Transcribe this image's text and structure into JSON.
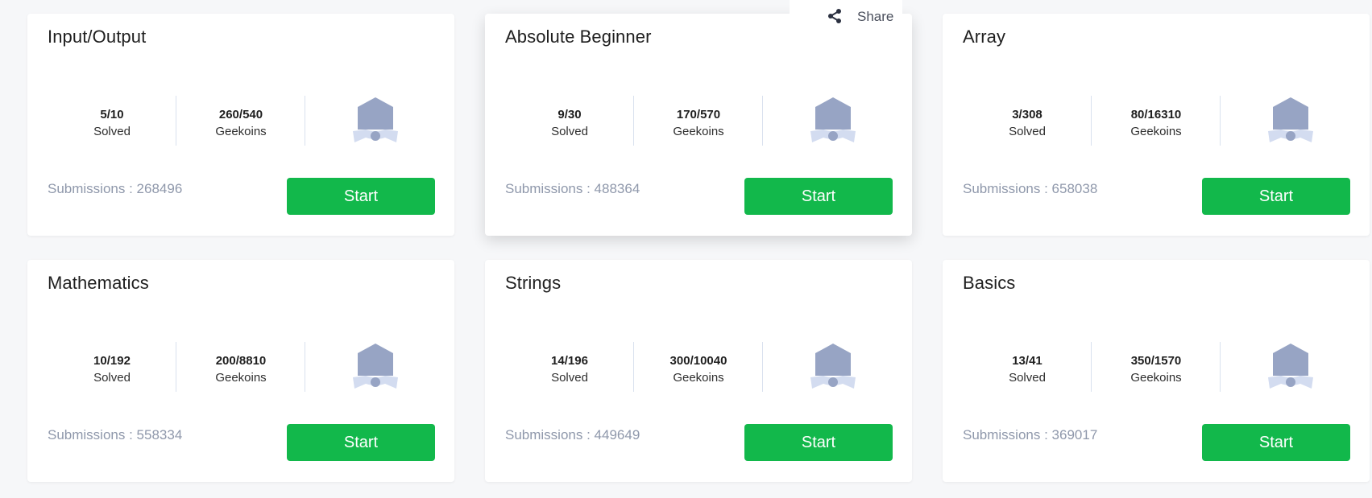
{
  "share": {
    "label": "Share",
    "icon": "share-icon"
  },
  "cards": [
    {
      "title": "Input/Output",
      "solved": "5/10",
      "solved_label": "Solved",
      "geekoins": "260/540",
      "geekoins_label": "Geekoins",
      "submissions": "Submissions : 268496",
      "button": "Start"
    },
    {
      "title": "Absolute Beginner",
      "solved": "9/30",
      "solved_label": "Solved",
      "geekoins": "170/570",
      "geekoins_label": "Geekoins",
      "submissions": "Submissions : 488364",
      "button": "Start"
    },
    {
      "title": "Array",
      "solved": "3/308",
      "solved_label": "Solved",
      "geekoins": "80/16310",
      "geekoins_label": "Geekoins",
      "submissions": "Submissions : 658038",
      "button": "Start"
    },
    {
      "title": "Mathematics",
      "solved": "10/192",
      "solved_label": "Solved",
      "geekoins": "200/8810",
      "geekoins_label": "Geekoins",
      "submissions": "Submissions : 558334",
      "button": "Start"
    },
    {
      "title": "Strings",
      "solved": "14/196",
      "solved_label": "Solved",
      "geekoins": "300/10040",
      "geekoins_label": "Geekoins",
      "submissions": "Submissions : 449649",
      "button": "Start"
    },
    {
      "title": "Basics",
      "solved": "13/41",
      "solved_label": "Solved",
      "geekoins": "350/1570",
      "geekoins_label": "Geekoins",
      "submissions": "Submissions : 369017",
      "button": "Start"
    }
  ],
  "colors": {
    "start_button": "#12b84b",
    "submissions_text": "#8f98ab",
    "badge": "#97a4c4",
    "badge_ribbon": "#d3dcf0"
  }
}
